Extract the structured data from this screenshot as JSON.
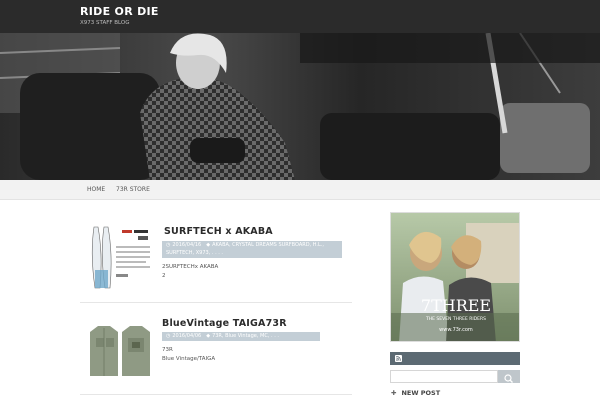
{
  "site": {
    "title": "RIDE OR DIE",
    "description": "X973 STAFF BLOG"
  },
  "nav": {
    "items": [
      {
        "label": "HOME"
      },
      {
        "label": "73R STORE"
      }
    ]
  },
  "posts": [
    {
      "title": "SURFTECH x AKABA",
      "date": "2016/04/16",
      "tags": "AKABA, CRYSTAL DREAMS SURFBOARD, H.L., SURFTECH, X973, . . . .",
      "excerpt_lines": [
        "2SURFTECHx AKABA",
        "2"
      ]
    },
    {
      "title": "BlueVintage TAIGA73R",
      "date": "2016/04/06",
      "tags": "73R, Blue Vintage, MC, . . .",
      "excerpt_lines": [
        "73R",
        "Blue Vintage/TAIGA"
      ]
    }
  ],
  "sidebar": {
    "ad": {
      "brand": "7THREE",
      "tagline": "THE SEVEN THREE RIDERS",
      "url": "www.73r.com"
    },
    "search": {
      "placeholder": ""
    },
    "new_post_label": "NEW POST"
  },
  "colors": {
    "header_bg": "#2b2b2b",
    "nav_bg": "#f2f2f2",
    "meta_bg": "#c3ced6",
    "rss_bar": "#5c6a73",
    "search_btn": "#bfc6cb"
  },
  "icons": {
    "clock": "clock-icon",
    "tag": "tag-icon",
    "rss": "rss-icon",
    "search": "search-icon",
    "plus": "plus-icon"
  }
}
